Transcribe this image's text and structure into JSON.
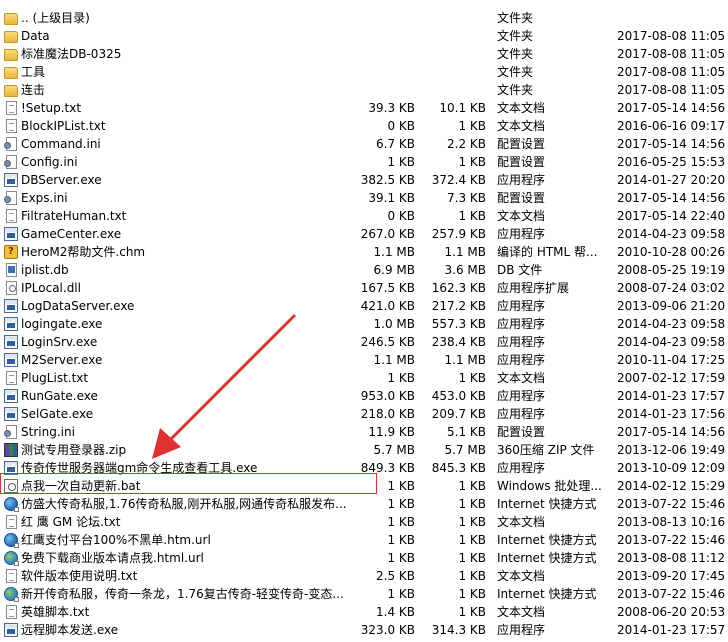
{
  "files": [
    {
      "icon": "folder-icon",
      "name": ".. (上级目录)",
      "size": "",
      "packed": "",
      "type": "文件夹",
      "date": ""
    },
    {
      "icon": "folder-icon",
      "name": "Data",
      "size": "",
      "packed": "",
      "type": "文件夹",
      "date": "2017-08-08 11:05"
    },
    {
      "icon": "folder-icon",
      "name": "标准魔法DB-0325",
      "size": "",
      "packed": "",
      "type": "文件夹",
      "date": "2017-08-08 11:05"
    },
    {
      "icon": "folder-icon",
      "name": "工具",
      "size": "",
      "packed": "",
      "type": "文件夹",
      "date": "2017-08-08 11:05"
    },
    {
      "icon": "folder-icon",
      "name": "连击",
      "size": "",
      "packed": "",
      "type": "文件夹",
      "date": "2017-08-08 11:05"
    },
    {
      "icon": "text-file-icon",
      "name": "!Setup.txt",
      "size": "39.3 KB",
      "packed": "10.1 KB",
      "type": "文本文档",
      "date": "2017-05-14 14:56"
    },
    {
      "icon": "text-file-icon",
      "name": "BlockIPList.txt",
      "size": "0 KB",
      "packed": "1 KB",
      "type": "文本文档",
      "date": "2016-06-16 09:17"
    },
    {
      "icon": "config-file-icon",
      "name": "Command.ini",
      "size": "6.7 KB",
      "packed": "2.2 KB",
      "type": "配置设置",
      "date": "2017-05-14 14:56"
    },
    {
      "icon": "config-file-icon",
      "name": "Config.ini",
      "size": "1 KB",
      "packed": "1 KB",
      "type": "配置设置",
      "date": "2016-05-25 15:53"
    },
    {
      "icon": "application-icon",
      "name": "DBServer.exe",
      "size": "382.5 KB",
      "packed": "372.4 KB",
      "type": "应用程序",
      "date": "2014-01-27 20:20"
    },
    {
      "icon": "config-file-icon",
      "name": "Exps.ini",
      "size": "39.1 KB",
      "packed": "7.3 KB",
      "type": "配置设置",
      "date": "2017-05-14 14:56"
    },
    {
      "icon": "text-file-icon",
      "name": "FiltrateHuman.txt",
      "size": "0 KB",
      "packed": "1 KB",
      "type": "文本文档",
      "date": "2017-05-14 22:40"
    },
    {
      "icon": "application-icon",
      "name": "GameCenter.exe",
      "size": "267.0 KB",
      "packed": "257.9 KB",
      "type": "应用程序",
      "date": "2014-04-23 09:58"
    },
    {
      "icon": "help-file-icon",
      "name": "HeroM2帮助文件.chm",
      "size": "1.1 MB",
      "packed": "1.1 MB",
      "type": "编译的 HTML 帮...",
      "date": "2010-10-28 00:26"
    },
    {
      "icon": "database-file-icon",
      "name": "iplist.db",
      "size": "6.9 MB",
      "packed": "3.6 MB",
      "type": "DB 文件",
      "date": "2008-05-25 19:19"
    },
    {
      "icon": "dll-file-icon",
      "name": "IPLocal.dll",
      "size": "167.5 KB",
      "packed": "162.3 KB",
      "type": "应用程序扩展",
      "date": "2008-07-24 03:02"
    },
    {
      "icon": "application-icon",
      "name": "LogDataServer.exe",
      "size": "421.0 KB",
      "packed": "217.2 KB",
      "type": "应用程序",
      "date": "2013-09-06 21:20"
    },
    {
      "icon": "application-icon",
      "name": "logingate.exe",
      "size": "1.0 MB",
      "packed": "557.3 KB",
      "type": "应用程序",
      "date": "2014-04-23 09:58"
    },
    {
      "icon": "application-icon",
      "name": "LoginSrv.exe",
      "size": "246.5 KB",
      "packed": "238.4 KB",
      "type": "应用程序",
      "date": "2014-04-23 09:58"
    },
    {
      "icon": "application-icon",
      "name": "M2Server.exe",
      "size": "1.1 MB",
      "packed": "1.1 MB",
      "type": "应用程序",
      "date": "2010-11-04 17:25"
    },
    {
      "icon": "text-file-icon",
      "name": "PlugList.txt",
      "size": "1 KB",
      "packed": "1 KB",
      "type": "文本文档",
      "date": "2007-02-12 17:59"
    },
    {
      "icon": "application-icon",
      "name": "RunGate.exe",
      "size": "953.0 KB",
      "packed": "453.0 KB",
      "type": "应用程序",
      "date": "2014-01-23 17:57"
    },
    {
      "icon": "application-icon",
      "name": "SelGate.exe",
      "size": "218.0 KB",
      "packed": "209.7 KB",
      "type": "应用程序",
      "date": "2014-01-23 17:56"
    },
    {
      "icon": "config-file-icon",
      "name": "String.ini",
      "size": "11.9 KB",
      "packed": "5.1 KB",
      "type": "配置设置",
      "date": "2017-05-14 14:56"
    },
    {
      "icon": "zip-archive-icon",
      "name": "测试专用登录器.zip",
      "size": "5.7 MB",
      "packed": "5.7 MB",
      "type": "360压缩 ZIP 文件",
      "date": "2013-12-06 19:49"
    },
    {
      "icon": "application-icon",
      "name": "传奇传世服务器端gm命令生成查看工具.exe",
      "size": "849.3 KB",
      "packed": "845.3 KB",
      "type": "应用程序",
      "date": "2013-10-09 12:09"
    },
    {
      "icon": "batch-file-icon",
      "name": "点我一次自动更新.bat",
      "size": "1 KB",
      "packed": "1 KB",
      "type": "Windows 批处理...",
      "date": "2014-02-12 15:29"
    },
    {
      "icon": "internet-shortcut-icon",
      "name": "仿盛大传奇私服,1.76传奇私服,刚开私服,网通传奇私服发布...",
      "size": "1 KB",
      "packed": "1 KB",
      "type": "Internet 快捷方式",
      "date": "2013-07-22 15:46"
    },
    {
      "icon": "text-file-icon",
      "name": "红 鹰 GM 论坛.txt",
      "size": "1 KB",
      "packed": "1 KB",
      "type": "文本文档",
      "date": "2013-08-13 10:16"
    },
    {
      "icon": "internet-shortcut-icon",
      "name": "红鹰支付平台100%不黑单.htm.url",
      "size": "1 KB",
      "packed": "1 KB",
      "type": "Internet 快捷方式",
      "date": "2013-07-22 15:46"
    },
    {
      "icon": "internet-shortcut-icon",
      "name": "免费下载商业版本请点我.html.url",
      "size": "1 KB",
      "packed": "1 KB",
      "type": "Internet 快捷方式",
      "date": "2013-08-08 11:12"
    },
    {
      "icon": "text-file-icon",
      "name": "软件版本使用说明.txt",
      "size": "2.5 KB",
      "packed": "1 KB",
      "type": "文本文档",
      "date": "2013-09-20 17:45"
    },
    {
      "icon": "internet-shortcut-icon",
      "name": "新开传奇私服，传奇一条龙，1.76复古传奇-轻变传奇-变态...",
      "size": "1 KB",
      "packed": "1 KB",
      "type": "Internet 快捷方式",
      "date": "2013-07-22 15:46"
    },
    {
      "icon": "text-file-icon",
      "name": "英雄脚本.txt",
      "size": "1.4 KB",
      "packed": "1 KB",
      "type": "文本文档",
      "date": "2008-06-20 20:53"
    },
    {
      "icon": "application-icon",
      "name": "远程脚本发送.exe",
      "size": "323.0 KB",
      "packed": "314.3 KB",
      "type": "应用程序",
      "date": "2014-01-23 17:57"
    }
  ],
  "annotation": {
    "color": "#e0302f",
    "highlighted_file_index": 26
  }
}
